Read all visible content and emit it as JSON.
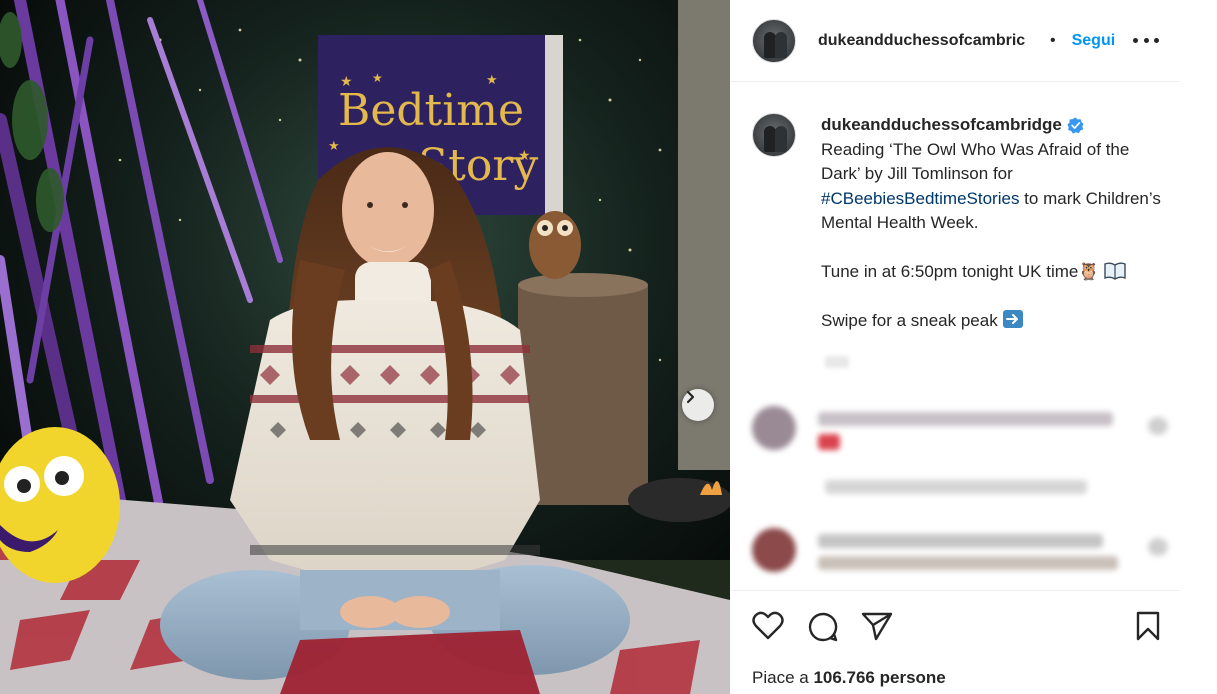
{
  "post": {
    "username": "dukeandduchessofcambridge",
    "header_username": "dukeandduchessofcambric",
    "separator": "•",
    "follow_label": "Segui",
    "photo": {
      "sign_line1": "Bedtime",
      "sign_line2": "Story"
    },
    "caption": {
      "line1": "Reading ‘The Owl Who Was Afraid of the Dark’ by Jill Tomlinson for",
      "hashtag": "#CBeebiesBedtimeStories",
      "line2": " to mark Children’s Mental Health Week.",
      "line3": "Tune in at 6:50pm tonight UK time",
      "line3_emoji": "🦉",
      "line4": "Swipe for a sneak peak",
      "line4_emoji": "➡️"
    },
    "likes_prefix": "Piace a ",
    "likes_count": "106.766",
    "likes_suffix": " persone"
  },
  "icons": {
    "more": "more-options-icon",
    "verified": "verified-badge-icon",
    "next": "chevron-right-icon",
    "like": "heart-icon",
    "comment": "comment-bubble-icon",
    "share": "paper-plane-icon",
    "save": "bookmark-icon"
  },
  "colors": {
    "follow": "#0095f6",
    "hashtag": "#00376b",
    "verified": "#3897f0",
    "text": "#262626"
  }
}
